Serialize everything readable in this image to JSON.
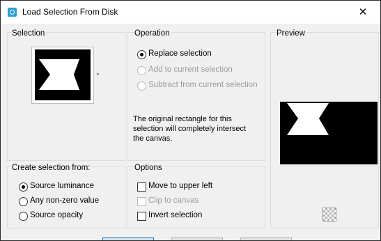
{
  "window": {
    "title": "Load Selection From Disk",
    "close_glyph": "✕",
    "app_icon": "paintshop-icon"
  },
  "selection": {
    "title": "Selection"
  },
  "operation": {
    "title": "Operation",
    "options": [
      {
        "label": "Replace selection",
        "selected": true,
        "enabled": true
      },
      {
        "label": "Add to current selection",
        "selected": false,
        "enabled": false
      },
      {
        "label": "Subtract from current selection",
        "selected": false,
        "enabled": false
      }
    ],
    "note": "The original rectangle for this selection will completely intersect the canvas."
  },
  "preview": {
    "title": "Preview",
    "checker_icon": "transparency-checker-icon"
  },
  "create_from": {
    "title": "Create selection from:",
    "options": [
      {
        "label": "Source luminance",
        "selected": true
      },
      {
        "label": "Any non-zero value",
        "selected": false
      },
      {
        "label": "Source opacity",
        "selected": false
      }
    ]
  },
  "options": {
    "title": "Options",
    "items": [
      {
        "label": "Move to upper left",
        "checked": false,
        "enabled": true
      },
      {
        "label": "Clip to canvas",
        "checked": false,
        "enabled": false
      },
      {
        "label": "Invert selection",
        "checked": false,
        "enabled": true
      }
    ]
  },
  "colors": {
    "accent": "#0078d7",
    "app_icon": "#2b9fd6"
  }
}
